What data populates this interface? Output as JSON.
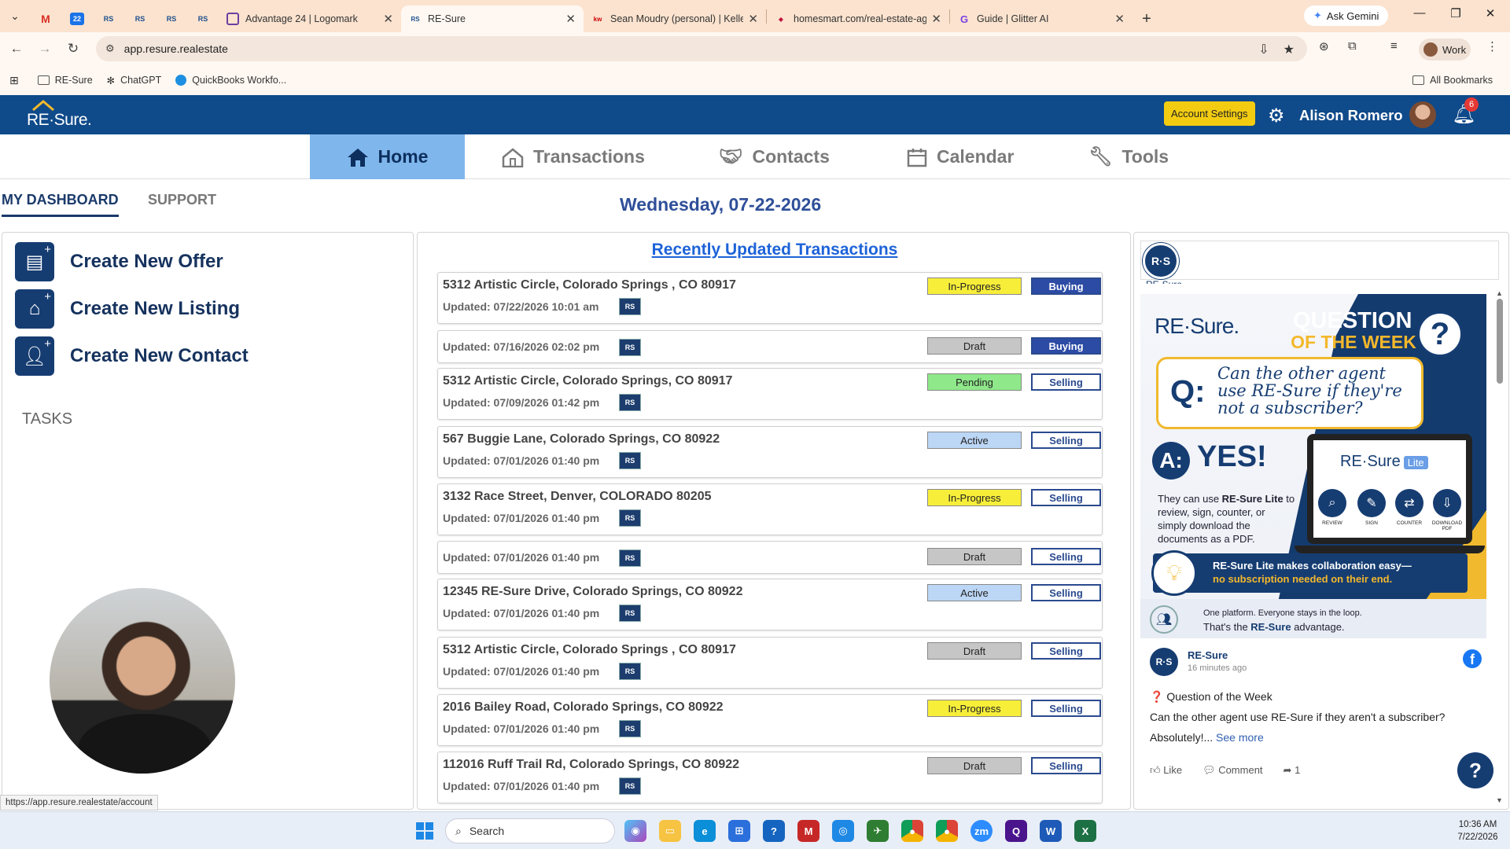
{
  "browser": {
    "pinned_tabs": [
      {
        "icon": "gmail-icon",
        "label": "M"
      },
      {
        "icon": "calendar-icon",
        "label": "22"
      },
      {
        "icon": "resure-icon",
        "label": "RS"
      },
      {
        "icon": "resure-icon",
        "label": "RS"
      },
      {
        "icon": "resure-icon",
        "label": "RS"
      },
      {
        "icon": "resure-icon",
        "label": "RS"
      }
    ],
    "tabs": [
      {
        "title": "Advantage 24 | Logomark",
        "active": false
      },
      {
        "title": "RE-Sure",
        "active": true
      },
      {
        "title": "Sean Moudry (personal) | Keller",
        "active": false
      },
      {
        "title": "homesmart.com/real-estate-ag",
        "active": false
      },
      {
        "title": "Guide | Glitter AI",
        "active": false
      }
    ],
    "ask_gemini": "Ask Gemini",
    "url": "app.resure.realestate",
    "profile_label": "Work",
    "bookmarks": [
      "RE-Sure",
      "ChatGPT",
      "QuickBooks Workfo..."
    ],
    "all_bookmarks": "All Bookmarks",
    "status_url": "https://app.resure.realestate/account"
  },
  "header": {
    "logo_text": "RE·Sure.",
    "account_settings": "Account Settings",
    "user_name": "Alison Romero",
    "notification_count": "6"
  },
  "nav": {
    "items": [
      {
        "label": "Home",
        "icon": "home-icon",
        "active": true
      },
      {
        "label": "Transactions",
        "icon": "house-icon",
        "active": false
      },
      {
        "label": "Contacts",
        "icon": "handshake-icon",
        "active": false
      },
      {
        "label": "Calendar",
        "icon": "calendar-icon",
        "active": false
      },
      {
        "label": "Tools",
        "icon": "wrench-icon",
        "active": false
      }
    ]
  },
  "subnav": {
    "dashboard": "MY DASHBOARD",
    "support": "SUPPORT",
    "date": "Wednesday, 07-22-2026"
  },
  "actions": [
    {
      "label": "Create New Offer",
      "icon": "new-document-icon"
    },
    {
      "label": "Create New Listing",
      "icon": "new-house-icon"
    },
    {
      "label": "Create New Contact",
      "icon": "new-person-icon"
    }
  ],
  "tasks_heading": "TASKS",
  "transactions": {
    "title": "Recently Updated Transactions",
    "items": [
      {
        "address": "5312 Artistic Circle, Colorado Springs , CO 80917",
        "updated": "Updated: 07/22/2026 10:01 am",
        "status": "In-Progress",
        "role": "Buying"
      },
      {
        "address": "",
        "updated": "Updated: 07/16/2026 02:02 pm",
        "status": "Draft",
        "role": "Buying"
      },
      {
        "address": "5312 Artistic Circle, Colorado Springs, CO 80917",
        "updated": "Updated: 07/09/2026 01:42 pm",
        "status": "Pending",
        "role": "Selling"
      },
      {
        "address": "567 Buggie Lane, Colorado Springs, CO 80922",
        "updated": "Updated: 07/01/2026 01:40 pm",
        "status": "Active",
        "role": "Selling"
      },
      {
        "address": "3132 Race Street, Denver, COLORADO 80205",
        "updated": "Updated: 07/01/2026 01:40 pm",
        "status": "In-Progress",
        "role": "Selling"
      },
      {
        "address": "",
        "updated": "Updated: 07/01/2026 01:40 pm",
        "status": "Draft",
        "role": "Selling"
      },
      {
        "address": "12345 RE-Sure Drive, Colorado Springs, CO 80922",
        "updated": "Updated: 07/01/2026 01:40 pm",
        "status": "Active",
        "role": "Selling"
      },
      {
        "address": "5312 Artistic Circle, Colorado Springs , CO 80917",
        "updated": "Updated: 07/01/2026 01:40 pm",
        "status": "Draft",
        "role": "Selling"
      },
      {
        "address": "2016 Bailey Road, Colorado Springs, CO 80922",
        "updated": "Updated: 07/01/2026 01:40 pm",
        "status": "In-Progress",
        "role": "Selling"
      },
      {
        "address": "112016 Ruff Trail Rd, Colorado Springs, CO 80922",
        "updated": "Updated: 07/01/2026 01:40 pm",
        "status": "Draft",
        "role": "Selling"
      }
    ],
    "badge_text": "RS"
  },
  "status_colors": {
    "In-Progress": "#f7ee3a",
    "Draft": "#c6c6c6",
    "Pending": "#8fe88a",
    "Active": "#bcd6f5"
  },
  "social": {
    "page_logo": "R·S",
    "page_name_cut": "RE-Sure",
    "promo": {
      "brand": "RE·Sure.",
      "qotw_1": "QUESTION",
      "qotw_2": "OF THE WEEK",
      "q_label": "Q:",
      "question": "Can the other agent use RE-Sure if they're not a subscriber?",
      "a_label": "A:",
      "yes": "YES!",
      "answer_pre": "They can use ",
      "answer_bold": "RE-Sure Lite",
      "answer_post": " to review, sign, counter, or simply download the documents as a PDF.",
      "lite_brand": "RE·Sure",
      "lite_tag": "Lite",
      "features": [
        "REVIEW",
        "SIGN",
        "COUNTER",
        "DOWNLOAD PDF"
      ],
      "collab_1": "RE-Sure Lite makes collaboration easy—",
      "collab_2": "no subscription needed on their end.",
      "footer_1": "One platform. Everyone stays in the loop.",
      "footer_2_pre": "That's the ",
      "footer_2_bold": "RE-Sure",
      "footer_2_post": " advantage."
    },
    "post": {
      "author": "RE-Sure",
      "time": "16 minutes ago",
      "line1": "Question of the Week",
      "line2": "Can the other agent use RE-Sure if they aren't a subscriber?",
      "line3": "Absolutely!...",
      "see_more": "See more",
      "like": "Like",
      "comment": "Comment",
      "share_count": "1"
    }
  },
  "taskbar": {
    "search_placeholder": "Search",
    "time": "10:36 AM",
    "date": "7/22/2026"
  }
}
